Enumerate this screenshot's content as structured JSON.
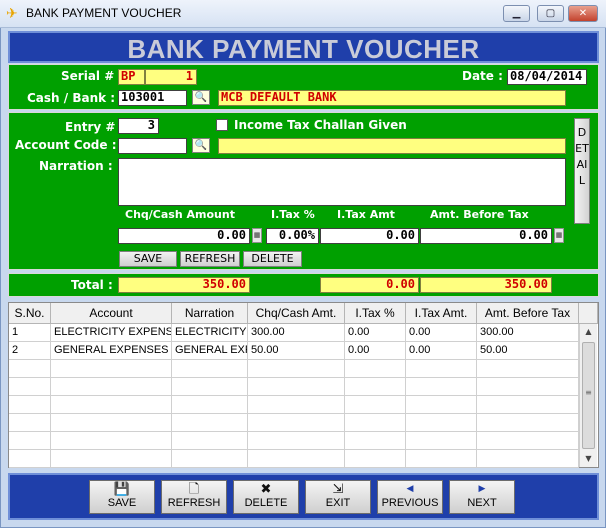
{
  "window": {
    "title": "BANK PAYMENT VOUCHER"
  },
  "header": {
    "title": "BANK PAYMENT VOUCHER"
  },
  "top": {
    "serial_label": "Serial #",
    "serial_prefix": "BP",
    "serial_no": "1",
    "date_label": "Date :",
    "date_value": "08/04/2014",
    "cash_bank_label": "Cash / Bank :",
    "cash_bank_code": "103001",
    "cash_bank_name": "MCB DEFAULT BANK"
  },
  "entry": {
    "entry_label": "Entry #",
    "entry_value": "3",
    "itc_label": "Income Tax Challan Given",
    "account_code_label": "Account Code :",
    "account_code_value": "",
    "account_name_value": "",
    "narration_label": "Narration :",
    "narration_value": "",
    "detail_label": "DETAIL",
    "col_chq": "Chq/Cash Amount",
    "col_itax_pct": "I.Tax %",
    "col_itax_amt": "I.Tax Amt",
    "col_before": "Amt. Before Tax",
    "chq_value": "0.00",
    "itax_pct_value": "0.00%",
    "itax_amt_value": "0.00",
    "before_value": "0.00",
    "save_label": "SAVE",
    "refresh_label": "REFRESH",
    "delete_label": "DELETE"
  },
  "totals": {
    "label": "Total :",
    "chq_total": "350.00",
    "itax_total": "0.00",
    "before_total": "350.00"
  },
  "grid": {
    "headers": [
      "S.No.",
      "Account",
      "Narration",
      "Chq/Cash Amt.",
      "I.Tax %",
      "I.Tax Amt.",
      "Amt. Before Tax"
    ],
    "rows": [
      [
        "1",
        "ELECTRICITY EXPENSES",
        "ELECTRICITY B",
        "300.00",
        "0.00",
        "0.00",
        "300.00"
      ],
      [
        "2",
        "GENERAL EXPENSES",
        "GENERAL EXPE",
        "50.00",
        "0.00",
        "0.00",
        "50.00"
      ]
    ]
  },
  "footer": {
    "save": "SAVE",
    "refresh": "REFRESH",
    "delete": "DELETE",
    "exit": "EXIT",
    "previous": "PREVIOUS",
    "next": "NEXT"
  }
}
